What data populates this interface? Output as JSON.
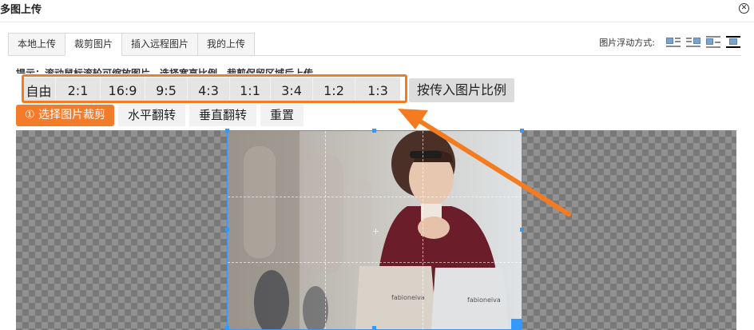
{
  "dialog": {
    "title": "多图上传",
    "close_icon": "close-icon"
  },
  "tabs": [
    {
      "label": "本地上传",
      "active": false
    },
    {
      "label": "裁剪图片",
      "active": true
    },
    {
      "label": "插入远程图片",
      "active": false
    },
    {
      "label": "我的上传",
      "active": false
    }
  ],
  "float_mode": {
    "label": "图片浮动方式:",
    "options": [
      "float-left-icon",
      "float-right-icon",
      "float-none-icon",
      "float-center-icon"
    ],
    "selected_index": 3
  },
  "tip": "提示：滚动鼠标滚轮可缩放图片，选择宽高比例，裁剪保留区域后上传",
  "ratios": [
    "自由",
    "2:1",
    "16:9",
    "9:5",
    "4:3",
    "1:1",
    "3:4",
    "1:2",
    "1:3"
  ],
  "ratio_original_label": "按传入图片比例",
  "actions": {
    "select_crop": "① 选择图片裁剪",
    "flip_horizontal": "水平翻转",
    "flip_vertical": "垂直翻转",
    "reset": "重置"
  },
  "colors": {
    "accent": "#f47b2a",
    "crop_border": "#3399ff",
    "highlight": "#f47b20"
  },
  "image": {
    "bag_left_text": "fabioneiva",
    "bag_right_text": "fabioneiva"
  }
}
